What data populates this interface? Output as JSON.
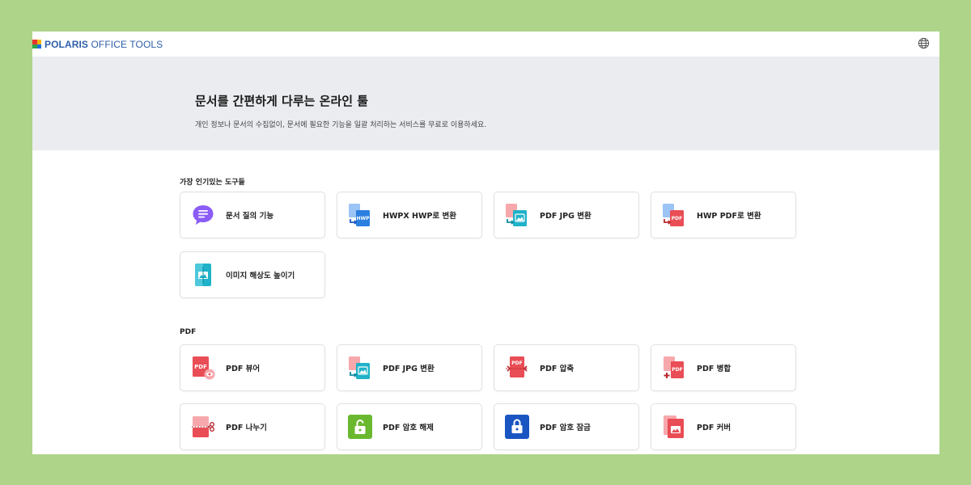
{
  "header": {
    "logo_bold": "POLARIS",
    "logo_rest": " OFFICE TOOLS",
    "language_icon": "globe-icon"
  },
  "hero": {
    "title": "문서를 간편하게 다루는 온라인 툴",
    "subtitle": "개인 정보나 문서의 수집없이, 문서에 필요한 기능을 일괄 처리하는 서비스를 무료로 이용하세요."
  },
  "popular": {
    "title": "가장 인기있는 도구들",
    "tools": [
      {
        "label": "문서 질의 기능",
        "icon": "chat-bubble-icon"
      },
      {
        "label": "HWPX HWP로 변환",
        "icon": "hwpx-to-hwp-icon"
      },
      {
        "label": "PDF JPG 변환",
        "icon": "pdf-to-jpg-icon"
      },
      {
        "label": "HWP PDF로 변환",
        "icon": "hwp-to-pdf-icon"
      },
      {
        "label": "이미지 해상도 높이기",
        "icon": "image-upscale-icon"
      }
    ]
  },
  "pdf": {
    "title": "PDF",
    "tools": [
      {
        "label": "PDF 뷰어",
        "icon": "pdf-viewer-icon"
      },
      {
        "label": "PDF JPG 변환",
        "icon": "pdf-to-jpg-icon"
      },
      {
        "label": "PDF 압축",
        "icon": "pdf-compress-icon"
      },
      {
        "label": "PDF 병합",
        "icon": "pdf-merge-icon"
      },
      {
        "label": "PDF 나누기",
        "icon": "pdf-split-icon"
      },
      {
        "label": "PDF 암호 해제",
        "icon": "unlock-icon"
      },
      {
        "label": "PDF 암호 잠금",
        "icon": "lock-icon"
      },
      {
        "label": "PDF 커버",
        "icon": "pdf-cover-icon"
      }
    ]
  },
  "colors": {
    "background": "#aed489",
    "hero_bg": "#eaecf0",
    "pdf_red": "#e94d55",
    "hwp_blue": "#2b7fe0",
    "teal": "#1fb2c8",
    "green": "#6ab82f",
    "navy": "#1a56c2",
    "purple": "#8b5cf6"
  }
}
